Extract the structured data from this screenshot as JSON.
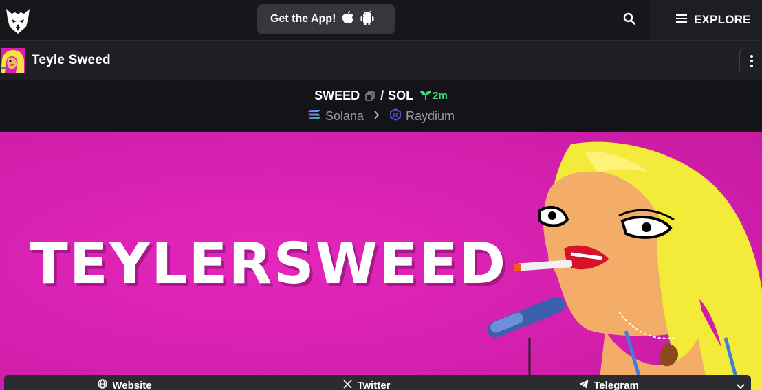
{
  "nav": {
    "get_app_label": "Get the App!",
    "explore_label": "EXPLORE"
  },
  "token": {
    "name": "Teyle Sweed"
  },
  "pair": {
    "base": "SWEED",
    "separator": "/",
    "quote": "SOL",
    "age": "2m",
    "chain": "Solana",
    "dex": "Raydium"
  },
  "banner": {
    "title": "TEYLERSWEED"
  },
  "links": [
    {
      "label": "Website",
      "icon": "globe-icon"
    },
    {
      "label": "Twitter",
      "icon": "x-icon"
    },
    {
      "label": "Telegram",
      "icon": "telegram-icon"
    }
  ],
  "colors": {
    "accent_green": "#3ee07a",
    "banner_magenta": "#dd22b6",
    "nav_bg": "#17171b"
  }
}
